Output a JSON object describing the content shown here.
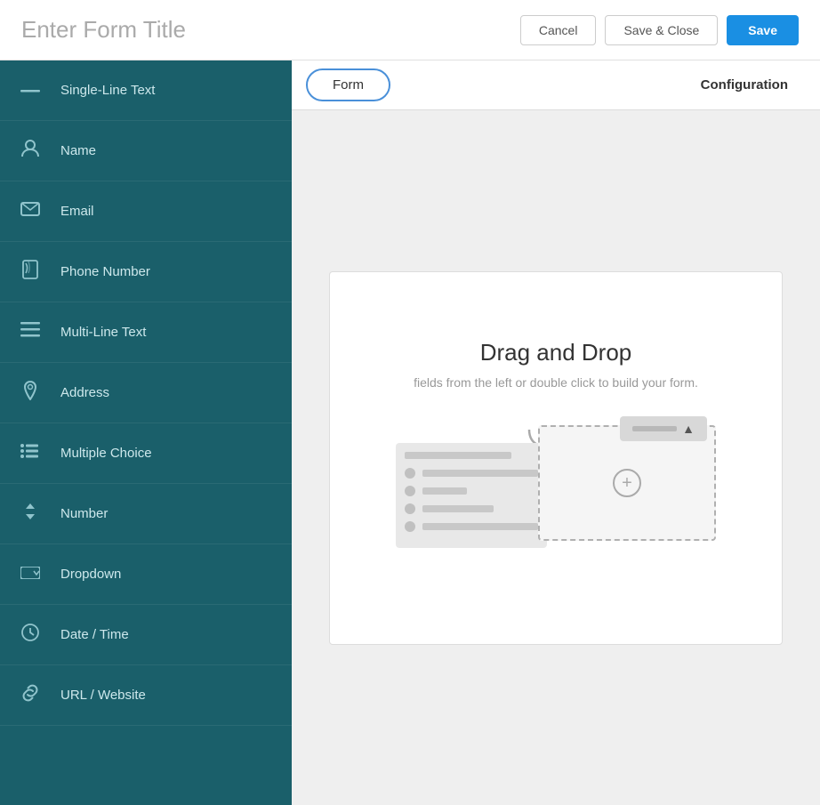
{
  "header": {
    "title": "Enter Form Title",
    "cancel_label": "Cancel",
    "save_close_label": "Save & Close",
    "save_label": "Save"
  },
  "sidebar": {
    "items": [
      {
        "id": "single-line-text",
        "label": "Single-Line Text",
        "icon": "—"
      },
      {
        "id": "name",
        "label": "Name",
        "icon": "👤"
      },
      {
        "id": "email",
        "label": "Email",
        "icon": "✉"
      },
      {
        "id": "phone-number",
        "label": "Phone Number",
        "icon": "📞"
      },
      {
        "id": "multi-line-text",
        "label": "Multi-Line Text",
        "icon": "≡"
      },
      {
        "id": "address",
        "label": "Address",
        "icon": "📍"
      },
      {
        "id": "multiple-choice",
        "label": "Multiple Choice",
        "icon": "☰"
      },
      {
        "id": "number",
        "label": "Number",
        "icon": "⬆"
      },
      {
        "id": "dropdown",
        "label": "Dropdown",
        "icon": "▭"
      },
      {
        "id": "date-time",
        "label": "Date / Time",
        "icon": "🕐"
      },
      {
        "id": "url-website",
        "label": "URL / Website",
        "icon": "🔗"
      }
    ]
  },
  "tabs": {
    "form_label": "Form",
    "configuration_label": "Configuration"
  },
  "canvas": {
    "drag_drop_title": "Drag and Drop",
    "drag_drop_subtitle": "fields from the left or double click to build your form."
  }
}
